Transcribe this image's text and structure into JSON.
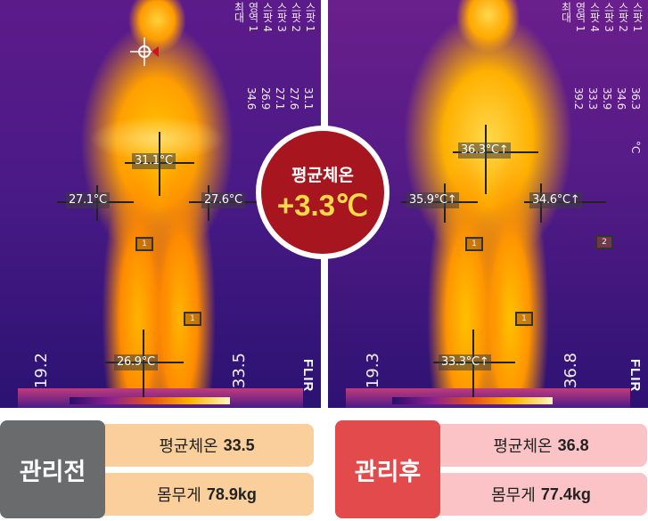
{
  "before_panel": {
    "legend": [
      "스팟 1",
      "스팟 2",
      "스팟 3",
      "스팟 4",
      "영역 1",
      "최대"
    ],
    "legend_values": [
      "31.1",
      "27.6",
      "27.1",
      "26.9",
      "34.6"
    ],
    "readings": {
      "chest": "31.1°C",
      "left_hip": "27.1°C",
      "right_hip": "27.6°C",
      "ankle": "26.9°C"
    },
    "box_labels": [
      "1",
      "1"
    ],
    "scale_min": "19.2",
    "scale_max": "33.5",
    "brand": "FLIR"
  },
  "after_panel": {
    "legend": [
      "스팟 1",
      "스팟 2",
      "스팟 3",
      "스팟 4",
      "영역 1",
      "최대"
    ],
    "legend_values": [
      "36.3",
      "34.6",
      "35.9",
      "33.3",
      "39.2"
    ],
    "unit": "°C",
    "readings": {
      "abdomen": "36.3°C↑",
      "left_hip": "35.9°C↑",
      "right_hip": "34.6°C↑",
      "ankle": "33.3°C↑"
    },
    "box_labels": [
      "1",
      "2",
      "1"
    ],
    "scale_min": "19.3",
    "scale_max": "36.8",
    "brand": "FLIR"
  },
  "center_badge": {
    "label": "평균체온",
    "value": "+3.3℃"
  },
  "summary": {
    "before": {
      "tag": "관리전",
      "avg_label": "평균체온",
      "avg_value": "33.5",
      "weight_label": "몸무게",
      "weight_value": "78.9kg"
    },
    "after": {
      "tag": "관리후",
      "avg_label": "평균체온",
      "avg_value": "36.8",
      "weight_label": "몸무게",
      "weight_value": "77.4kg"
    }
  },
  "colors": {
    "badge": "#a7151f",
    "badge_value": "#ffd94a",
    "before_tag": "#6a6b6d",
    "after_tag": "#e24a4b",
    "before_stat": "#fbcf9c",
    "after_stat": "#fbc3c6"
  }
}
